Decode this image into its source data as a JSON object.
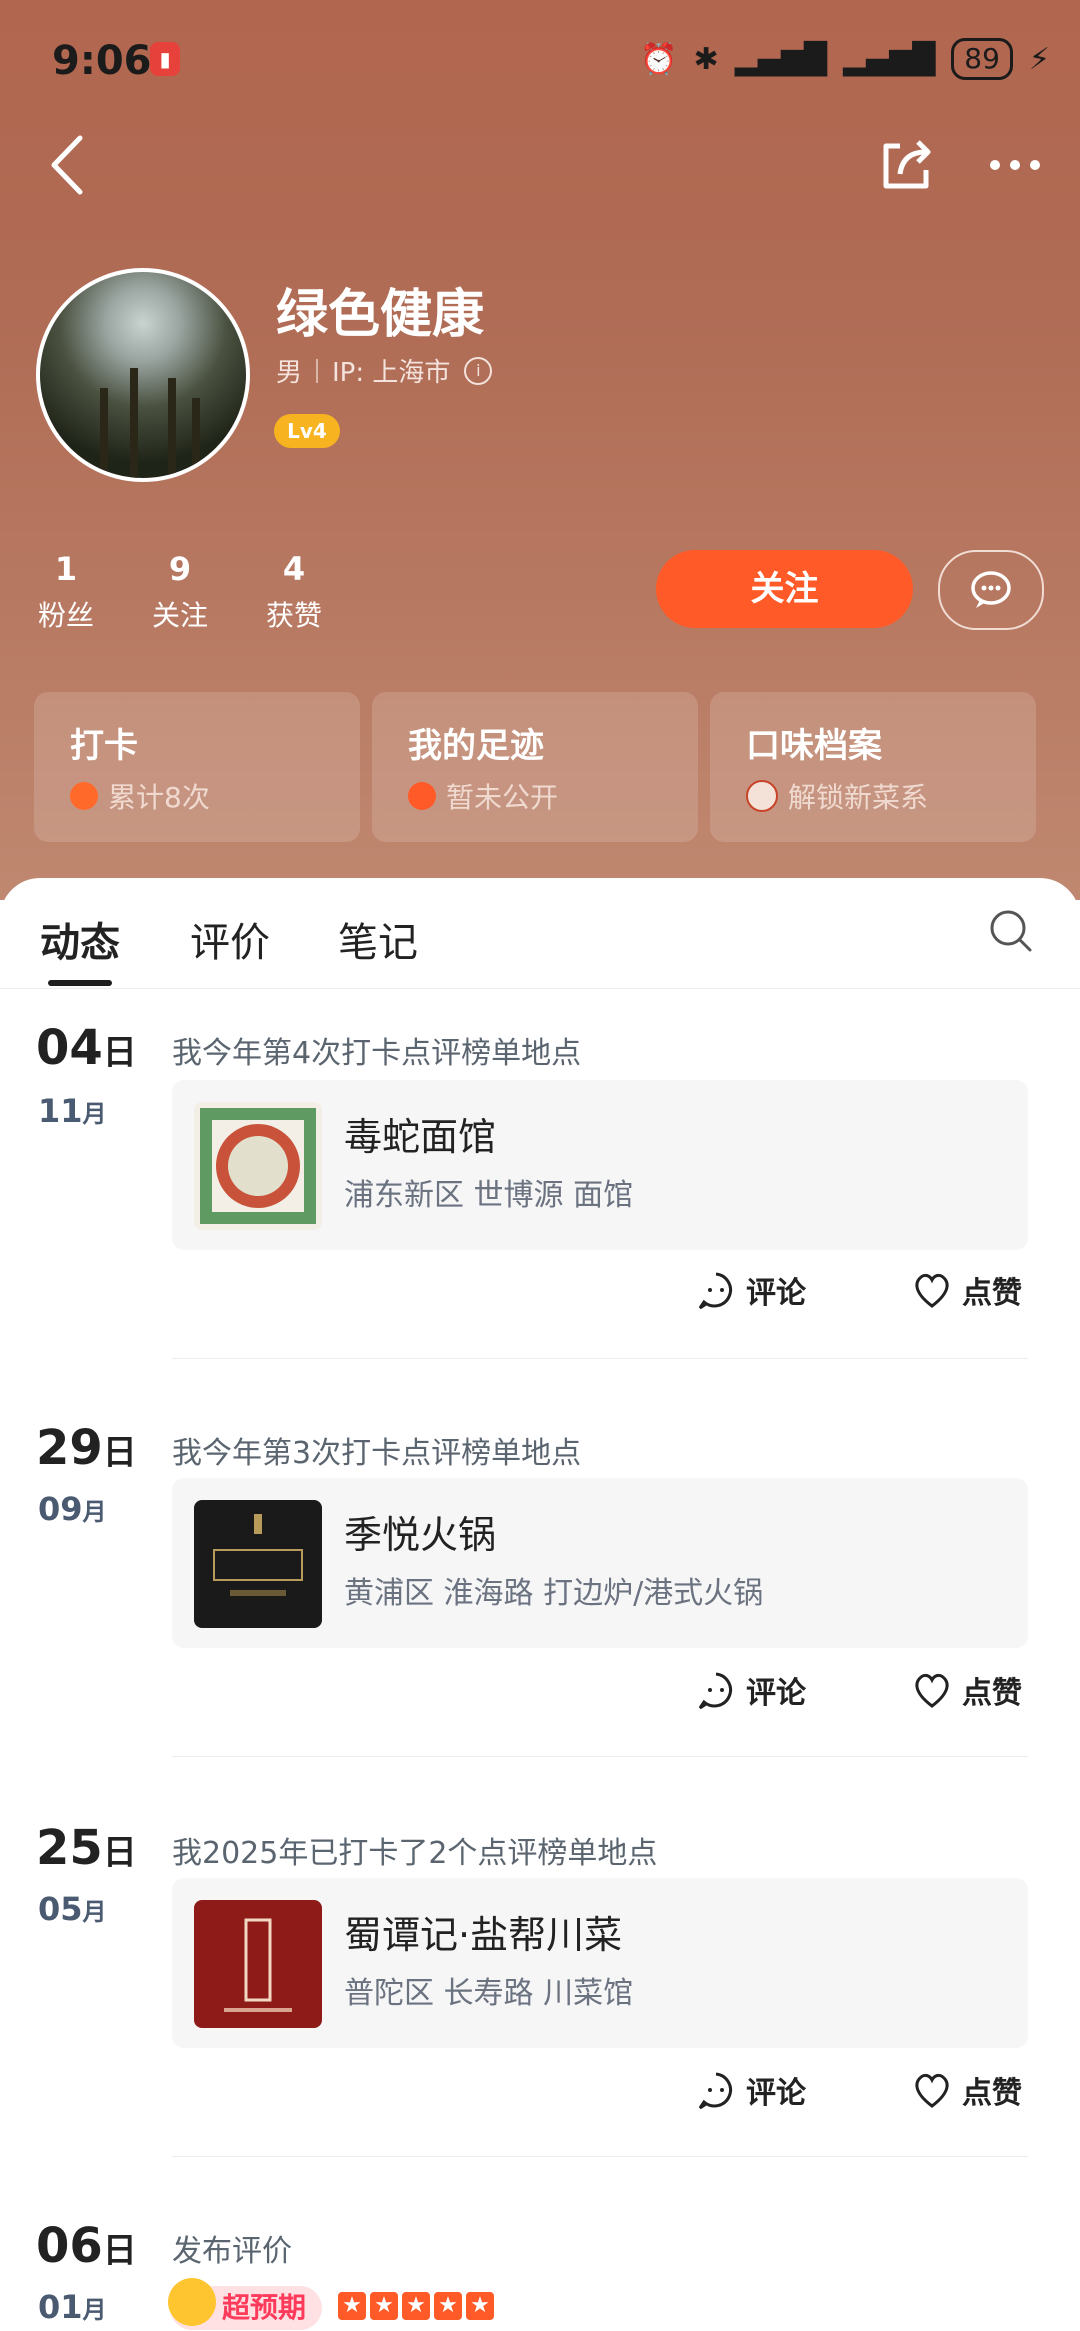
{
  "status_bar": {
    "time": "9:06",
    "battery": "89"
  },
  "profile": {
    "name": "绿色健康",
    "gender": "男",
    "ip": "IP: 上海市",
    "level": "Lv4"
  },
  "stats": [
    {
      "value": "1",
      "label": "粉丝"
    },
    {
      "value": "9",
      "label": "关注"
    },
    {
      "value": "4",
      "label": "获赞"
    }
  ],
  "actions": {
    "follow": "关注"
  },
  "cards": [
    {
      "title": "打卡",
      "subtitle": "累计8次",
      "icon": "check-badge-icon"
    },
    {
      "title": "我的足迹",
      "subtitle": "暂未公开",
      "icon": "location-arrow-icon"
    },
    {
      "title": "口味档案",
      "subtitle": "解锁新菜系",
      "icon": "food-icon"
    }
  ],
  "tabs": [
    "动态",
    "评价",
    "笔记"
  ],
  "feed": [
    {
      "day": "04",
      "day_unit": "日",
      "month": "11",
      "month_unit": "月",
      "text": "我今年第4次打卡点评榜单地点",
      "shop_name": "毒蛇面馆",
      "shop_addr": "浦东新区 世博源 面馆",
      "comment": "评论",
      "like": "点赞"
    },
    {
      "day": "29",
      "day_unit": "日",
      "month": "09",
      "month_unit": "月",
      "text": "我今年第3次打卡点评榜单地点",
      "shop_name": "季悦火锅",
      "shop_addr": "黄浦区 淮海路 打边炉/港式火锅",
      "comment": "评论",
      "like": "点赞"
    },
    {
      "day": "25",
      "day_unit": "日",
      "month": "05",
      "month_unit": "月",
      "text": "我2025年已打卡了2个点评榜单地点",
      "shop_name": "蜀谭记·盐帮川菜",
      "shop_addr": "普陀区 长寿路 川菜馆",
      "comment": "评论",
      "like": "点赞"
    },
    {
      "day": "06",
      "day_unit": "日",
      "month": "01",
      "month_unit": "月",
      "text": "发布评价",
      "badge": "超预期",
      "rating": 5
    }
  ],
  "colors": {
    "accent": "#ff5a27",
    "level": "#f7b320",
    "hero": "#b1664f"
  }
}
